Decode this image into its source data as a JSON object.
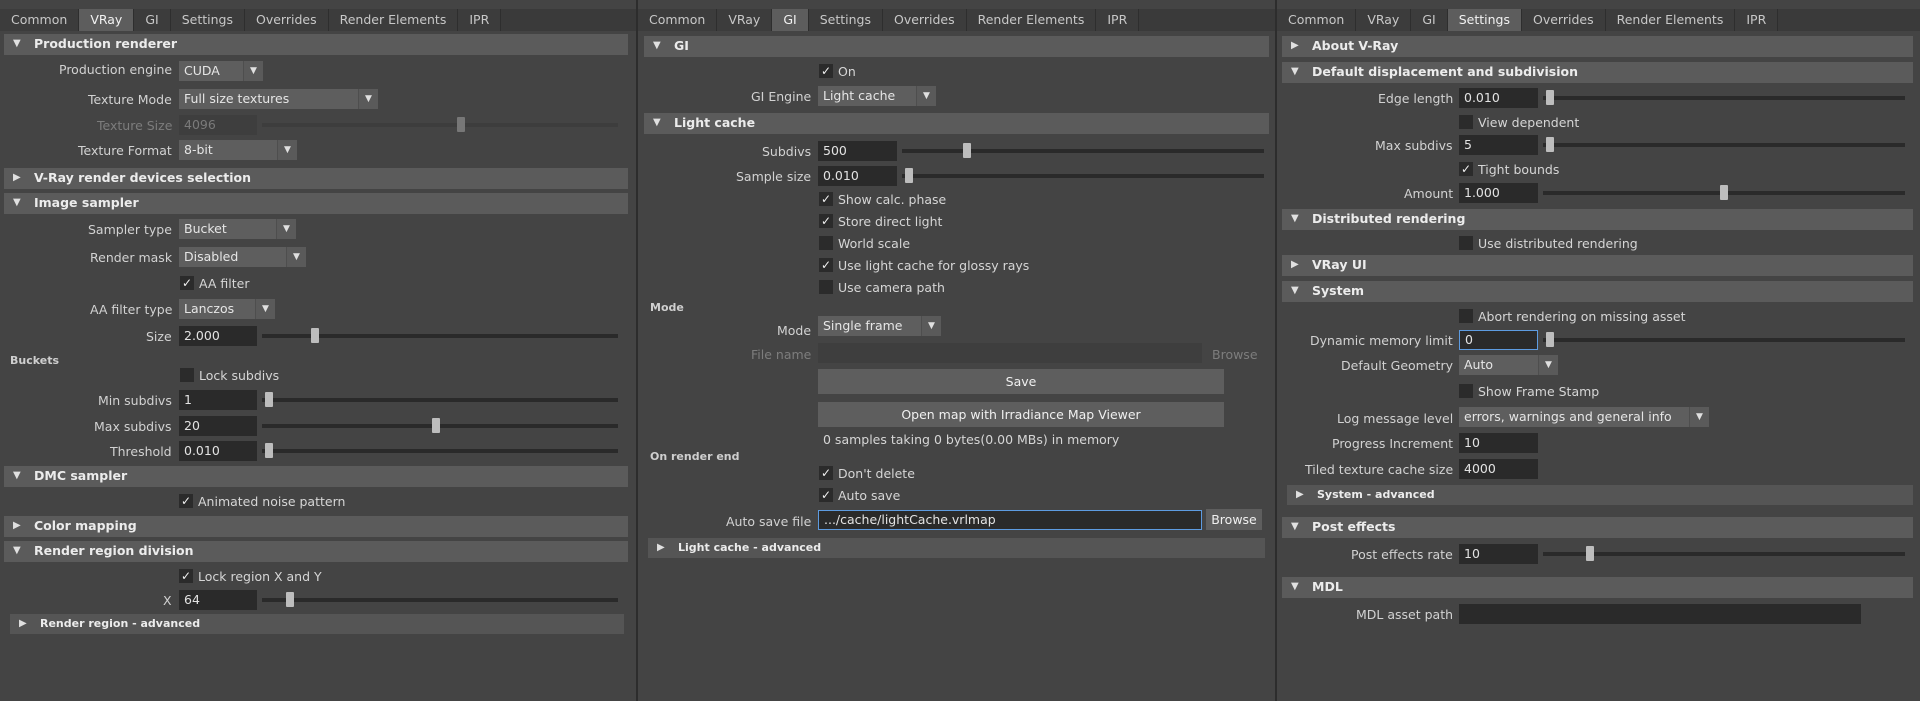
{
  "p1": {
    "tabs": [
      "Common",
      "VRay",
      "GI",
      "Settings",
      "Overrides",
      "Render Elements",
      "IPR"
    ],
    "production_renderer": "Production renderer",
    "production_engine_label": "Production engine",
    "production_engine": "CUDA",
    "texture_mode_label": "Texture Mode",
    "texture_mode": "Full size textures",
    "texture_size_label": "Texture Size",
    "texture_size": "4096",
    "texture_format_label": "Texture Format",
    "texture_format": "8-bit",
    "devices_section": "V-Ray render devices selection",
    "image_sampler": "Image sampler",
    "sampler_type_label": "Sampler type",
    "sampler_type": "Bucket",
    "render_mask_label": "Render mask",
    "render_mask": "Disabled",
    "aa_filter": "AA filter",
    "aa_filter_type_label": "AA filter type",
    "aa_filter_type": "Lanczos",
    "size_label": "Size",
    "size": "2.000",
    "buckets": "Buckets",
    "lock_subdivs": "Lock subdivs",
    "min_subdivs_label": "Min subdivs",
    "min_subdivs": "1",
    "max_subdivs_label": "Max subdivs",
    "max_subdivs": "20",
    "threshold_label": "Threshold",
    "threshold": "0.010",
    "dmc_sampler": "DMC sampler",
    "animated_noise": "Animated noise pattern",
    "color_mapping": "Color mapping",
    "render_region_division": "Render region division",
    "lock_region": "Lock region X and Y",
    "x_label": "X",
    "x": "64",
    "render_region_advanced": "Render region - advanced"
  },
  "p2": {
    "tabs": [
      "Common",
      "VRay",
      "GI",
      "Settings",
      "Overrides",
      "Render Elements",
      "IPR"
    ],
    "gi": "GI",
    "on": "On",
    "gi_engine_label": "GI Engine",
    "gi_engine": "Light cache",
    "light_cache": "Light cache",
    "subdivs_label": "Subdivs",
    "subdivs": "500",
    "sample_size_label": "Sample size",
    "sample_size": "0.010",
    "show_calc": "Show calc. phase",
    "store_direct": "Store direct light",
    "world_scale": "World scale",
    "use_glossy": "Use light cache for glossy rays",
    "use_camera": "Use camera path",
    "mode_header": "Mode",
    "mode_label": "Mode",
    "mode": "Single frame",
    "file_name_label": "File name",
    "browse1": "Browse",
    "save": "Save",
    "open_map": "Open map with Irradiance Map Viewer",
    "samples_info": "0 samples taking 0 bytes(0.00 MBs) in memory",
    "on_render_end": "On render end",
    "dont_delete": "Don't delete",
    "auto_save": "Auto save",
    "auto_save_file_label": "Auto save file",
    "auto_save_file": ".../cache/lightCache.vrlmap",
    "browse2": "Browse",
    "lc_advanced": "Light cache - advanced"
  },
  "p3": {
    "tabs": [
      "Common",
      "VRay",
      "GI",
      "Settings",
      "Overrides",
      "Render Elements",
      "IPR"
    ],
    "about": "About V-Ray",
    "default_disp": "Default displacement and subdivision",
    "edge_length_label": "Edge length",
    "edge_length": "0.010",
    "view_dependent": "View dependent",
    "max_subdivs_label": "Max subdivs",
    "max_subdivs": "5",
    "tight_bounds": "Tight bounds",
    "amount_label": "Amount",
    "amount": "1.000",
    "distributed": "Distributed rendering",
    "use_distributed": "Use distributed rendering",
    "vray_ui": "VRay UI",
    "system": "System",
    "abort_missing": "Abort rendering on missing asset",
    "dyn_mem_label": "Dynamic memory limit",
    "dyn_mem": "0",
    "default_geom_label": "Default Geometry",
    "default_geom": "Auto",
    "show_frame_stamp": "Show Frame Stamp",
    "log_level_label": "Log message level",
    "log_level": "errors, warnings and general info",
    "progress_inc_label": "Progress Increment",
    "progress_inc": "10",
    "tiled_cache_label": "Tiled texture cache size",
    "tiled_cache": "4000",
    "system_advanced": "System - advanced",
    "post_effects": "Post effects",
    "post_rate_label": "Post effects rate",
    "post_rate": "10",
    "mdl": "MDL",
    "mdl_path_label": "MDL asset path",
    "mdl_path": ""
  },
  "colors": {
    "bg": "#444444",
    "header": "#5b5b5b",
    "field": "#2a2a2a",
    "active_tab": "#5d5d5d",
    "focus": "#5d9be0"
  },
  "sliders": {
    "texture_size": 0.56,
    "size": 0.15,
    "min_subdivs": 0.02,
    "max_subdivs": 0.49,
    "threshold": 0.02,
    "x": 0.08,
    "subdivs": 0.18,
    "sample_size": 0.02,
    "edge_length": 0.02,
    "max_subdivs_p3": 0.02,
    "amount": 0.5,
    "dyn_mem": 0.02,
    "post_rate": 0.13
  }
}
